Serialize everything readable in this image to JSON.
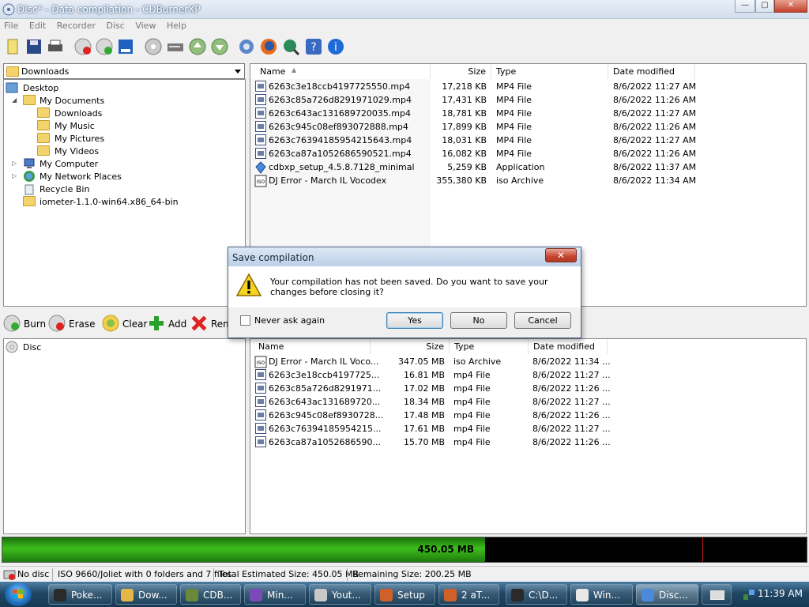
{
  "window": {
    "title": "Disc* - Data compilation - CDBurnerXP",
    "min_glyph": "—",
    "max_glyph": "▢",
    "close_glyph": "✕"
  },
  "menu": [
    "File",
    "Edit",
    "Recorder",
    "Disc",
    "View",
    "Help"
  ],
  "toolbar_icons": [
    "new-compilation-icon",
    "save-icon",
    "print-icon",
    "erase-disc-icon",
    "burn-disc-icon",
    "copy-disc-icon",
    "disc-info-icon",
    "drive-icon",
    "eject-icon",
    "refresh-icon",
    "settings-icon",
    "firefox-icon",
    "search-icon",
    "help-icon",
    "info-icon"
  ],
  "explorer": {
    "location": "Downloads",
    "tree": [
      {
        "label": "Desktop",
        "level": 0,
        "expander": ""
      },
      {
        "label": "My Documents",
        "level": 1,
        "expander": "◢"
      },
      {
        "label": "Downloads",
        "level": 2,
        "expander": ""
      },
      {
        "label": "My Music",
        "level": 2,
        "expander": ""
      },
      {
        "label": "My Pictures",
        "level": 2,
        "expander": ""
      },
      {
        "label": "My Videos",
        "level": 2,
        "expander": ""
      },
      {
        "label": "My Computer",
        "level": 1,
        "expander": "▷"
      },
      {
        "label": "My Network Places",
        "level": 1,
        "expander": "▷"
      },
      {
        "label": "Recycle Bin",
        "level": 1,
        "expander": ""
      },
      {
        "label": "iometer-1.1.0-win64.x86_64-bin",
        "level": 1,
        "expander": ""
      }
    ],
    "columns": {
      "name": "Name",
      "size": "Size",
      "type": "Type",
      "date": "Date modified"
    },
    "files": [
      {
        "name": "6263c3e18ccb4197725550.mp4",
        "size": "17,218 KB",
        "type": "MP4 File",
        "date": "8/6/2022 11:27 AM"
      },
      {
        "name": "6263c85a726d8291971029.mp4",
        "size": "17,431 KB",
        "type": "MP4 File",
        "date": "8/6/2022 11:26 AM"
      },
      {
        "name": "6263c643ac131689720035.mp4",
        "size": "18,781 KB",
        "type": "MP4 File",
        "date": "8/6/2022 11:27 AM"
      },
      {
        "name": "6263c945c08ef893072888.mp4",
        "size": "17,899 KB",
        "type": "MP4 File",
        "date": "8/6/2022 11:26 AM"
      },
      {
        "name": "6263c76394185954215643.mp4",
        "size": "18,031 KB",
        "type": "MP4 File",
        "date": "8/6/2022 11:27 AM"
      },
      {
        "name": "6263ca87a1052686590521.mp4",
        "size": "16,082 KB",
        "type": "MP4 File",
        "date": "8/6/2022 11:26 AM"
      },
      {
        "name": "cdbxp_setup_4.5.8.7128_minimal",
        "size": "5,259 KB",
        "type": "Application",
        "date": "8/6/2022 11:37 AM"
      },
      {
        "name": "DJ Error - March IL Vocodex",
        "size": "355,380 KB",
        "type": "iso Archive",
        "date": "8/6/2022 11:34 AM"
      }
    ]
  },
  "burnbar": [
    {
      "label": "Burn",
      "icon": "burn-icon"
    },
    {
      "label": "Erase",
      "icon": "erase-icon"
    },
    {
      "label": "Clear",
      "icon": "clear-icon"
    },
    {
      "label": "Add",
      "icon": "add-icon"
    },
    {
      "label": "Rem",
      "icon": "remove-icon"
    }
  ],
  "disc": {
    "root": "Disc",
    "columns": {
      "name": "Name",
      "size": "Size",
      "type": "Type",
      "date": "Date modified"
    },
    "files": [
      {
        "name": "DJ Error - March IL Voco...",
        "size": "347.05 MB",
        "type": "iso Archive",
        "date": "8/6/2022 11:34 ..."
      },
      {
        "name": "6263c3e18ccb4197725...",
        "size": "16.81 MB",
        "type": "mp4 File",
        "date": "8/6/2022 11:27 ..."
      },
      {
        "name": "6263c85a726d8291971...",
        "size": "17.02 MB",
        "type": "mp4 File",
        "date": "8/6/2022 11:26 ..."
      },
      {
        "name": "6263c643ac131689720...",
        "size": "18.34 MB",
        "type": "mp4 File",
        "date": "8/6/2022 11:27 ..."
      },
      {
        "name": "6263c945c08ef8930728...",
        "size": "17.48 MB",
        "type": "mp4 File",
        "date": "8/6/2022 11:26 ..."
      },
      {
        "name": "6263c76394185954215...",
        "size": "17.61 MB",
        "type": "mp4 File",
        "date": "8/6/2022 11:27 ..."
      },
      {
        "name": "6263ca87a1052686590...",
        "size": "15.70 MB",
        "type": "mp4 File",
        "date": "8/6/2022 11:26 ..."
      }
    ]
  },
  "capacity": {
    "used_label": "450.05 MB",
    "used_fraction": 0.6
  },
  "status": {
    "disc": "No disc",
    "filesystem": "ISO 9660/Joliet with 0 folders and 7 files",
    "total": "Total Estimated Size: 450.05 MB",
    "remaining": "Remaining Size: 200.25 MB"
  },
  "dialog": {
    "title": "Save compilation",
    "close_glyph": "✕",
    "message": "Your compilation has not been saved. Do you want to save your changes before closing it?",
    "checkbox": "Never ask again",
    "yes": "Yes",
    "no": "No",
    "cancel": "Cancel"
  },
  "taskbar": {
    "items": [
      {
        "label": "Poke...",
        "color": "#2a2a2a"
      },
      {
        "label": "Dow...",
        "color": "#e4b64a"
      },
      {
        "label": "CDB...",
        "color": "#6a8a3a"
      },
      {
        "label": "Min...",
        "color": "#7a4ab8"
      },
      {
        "label": "Yout...",
        "color": "#c8c8c8"
      },
      {
        "label": "Setup",
        "color": "#d0602a"
      },
      {
        "label": "2 aT...",
        "color": "#d0602a"
      },
      {
        "label": "C:\\D...",
        "color": "#2a2a2a"
      },
      {
        "label": "Win...",
        "color": "#e8e8e8"
      },
      {
        "label": "Disc...",
        "color": "#4a8ad8"
      }
    ],
    "clock": "11:39 AM"
  },
  "colors": {
    "capacity_fill": "#3dbf1c",
    "selection": "#3399ff"
  }
}
